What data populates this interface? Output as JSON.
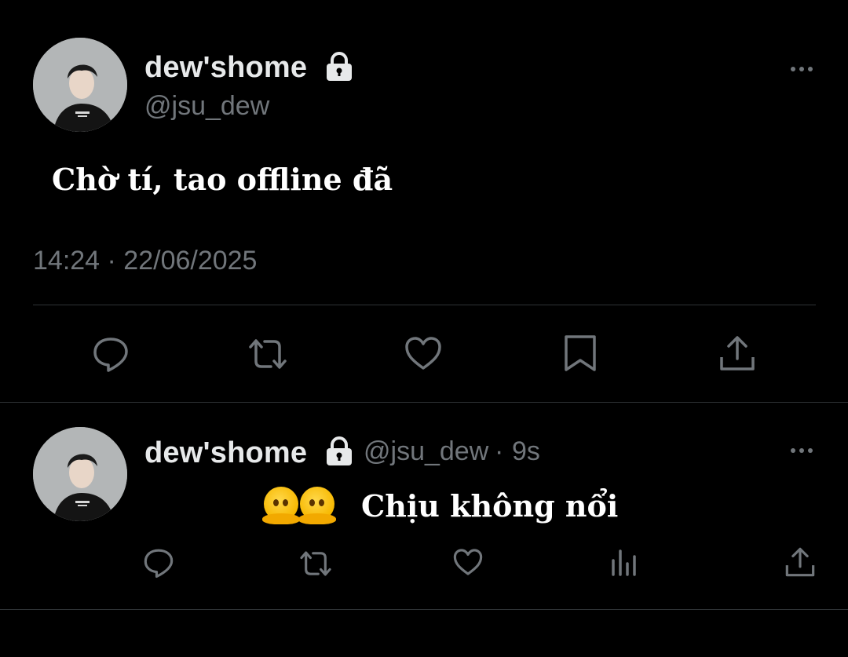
{
  "main_tweet": {
    "display_name": "dew'shome",
    "handle": "@jsu_dew",
    "text": "Chờ tí, tao offline đã",
    "timestamp": "14:24 · 22/06/2025",
    "actions": [
      "reply-icon",
      "retweet-icon",
      "like-icon",
      "bookmark-icon",
      "share-icon"
    ]
  },
  "reply": {
    "display_name": "dew'shome",
    "handle": "@jsu_dew",
    "separator": "·",
    "time_ago": "9s",
    "emojis": [
      "melting-face-emoji",
      "melting-face-emoji"
    ],
    "text": "Chịu không nổi",
    "actions": [
      "reply-icon",
      "retweet-icon",
      "like-icon",
      "views-icon",
      "share-icon"
    ]
  },
  "colors": {
    "background": "#000000",
    "primary_text": "#e7e9ea",
    "secondary_text": "#71767b",
    "divider": "#2f3336"
  }
}
